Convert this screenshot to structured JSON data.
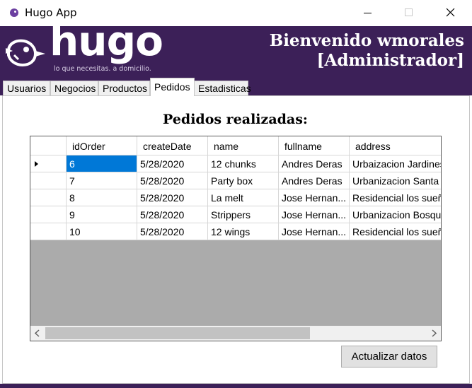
{
  "window": {
    "title": "Hugo App",
    "icon": "hugo-bird-icon",
    "controls": [
      "minimize-icon",
      "maximize-icon",
      "close-icon"
    ]
  },
  "header": {
    "logo_text": "hugo",
    "tagline": "lo que necesitas. a domicilio.",
    "welcome_line1": "Bienvenido wmorales",
    "welcome_line2": "[Administrador]",
    "background_color": "#3c2058"
  },
  "tabs": [
    {
      "label": "Usuarios",
      "active": false
    },
    {
      "label": "Negocios",
      "active": false
    },
    {
      "label": "Productos",
      "active": false
    },
    {
      "label": "Pedidos",
      "active": true
    },
    {
      "label": "Estadisticas",
      "active": false
    }
  ],
  "main": {
    "heading": "Pedidos realizadas:",
    "columns": [
      "idOrder",
      "createDate",
      "name",
      "fullname",
      "address"
    ],
    "rows": [
      {
        "idOrder": "6",
        "createDate": "5/28/2020",
        "name": "12 chunks",
        "fullname": "Andres Deras",
        "address": "Urbaizacion Jardines",
        "current": true
      },
      {
        "idOrder": "7",
        "createDate": "5/28/2020",
        "name": "Party box",
        "fullname": "Andres Deras",
        "address": "Urbanizacion Santa E",
        "current": false
      },
      {
        "idOrder": "8",
        "createDate": "5/28/2020",
        "name": "La melt",
        "fullname": "Jose Hernan...",
        "address": "Residencial los sueño",
        "current": false
      },
      {
        "idOrder": "9",
        "createDate": "5/28/2020",
        "name": "Strippers",
        "fullname": "Jose Hernan...",
        "address": "Urbanizacion Bosque",
        "current": false
      },
      {
        "idOrder": "10",
        "createDate": "5/28/2020",
        "name": "12 wings",
        "fullname": "Jose Hernan...",
        "address": "Residencial los sueño",
        "current": false
      }
    ],
    "refresh_button": "Actualizar datos",
    "selection_color": "#0078d7"
  }
}
